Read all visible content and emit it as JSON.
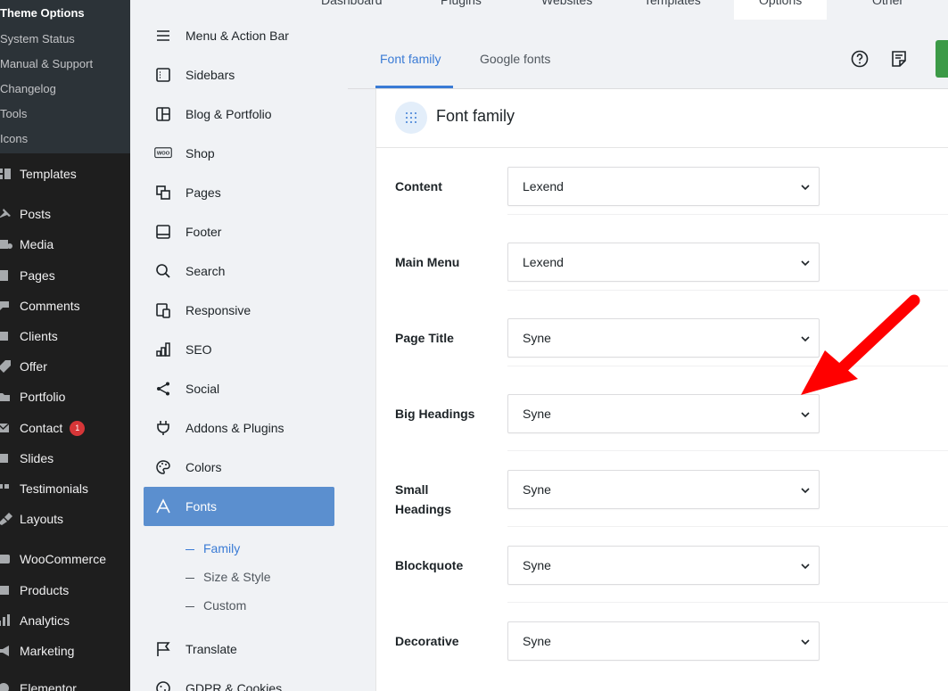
{
  "wp_sidebar": {
    "submenu": [
      "Theme Options",
      "System Status",
      "Manual & Support",
      "Changelog",
      "Tools",
      "Icons"
    ],
    "items": [
      "Templates",
      "Posts",
      "Media",
      "Pages",
      "Comments",
      "Clients",
      "Offer",
      "Portfolio",
      "Contact",
      "Slides",
      "Testimonials",
      "Layouts",
      "WooCommerce",
      "Products",
      "Analytics",
      "Marketing",
      "Elementor"
    ],
    "contact_badge": "1"
  },
  "top_tabs": [
    "Dashboard",
    "Plugins",
    "Websites",
    "Templates",
    "Options",
    "Other"
  ],
  "inner_nav": {
    "items": [
      "Menu & Action Bar",
      "Sidebars",
      "Blog & Portfolio",
      "Shop",
      "Pages",
      "Footer",
      "Search",
      "Responsive",
      "SEO",
      "Social",
      "Addons & Plugins",
      "Colors",
      "Fonts"
    ],
    "sub_items": [
      "Family",
      "Size & Style",
      "Custom"
    ],
    "after_items": [
      "Translate",
      "GDPR & Cookies"
    ],
    "shop_icon_text": "WOO"
  },
  "content_tabs": [
    "Font family",
    "Google fonts"
  ],
  "panel": {
    "title": "Font family",
    "rows": [
      {
        "label": "Content",
        "value": "Lexend"
      },
      {
        "label": "Main Menu",
        "value": "Lexend"
      },
      {
        "label": "Page Title",
        "value": "Syne"
      },
      {
        "label": "Big Headings",
        "value": "Syne"
      },
      {
        "label": "Small Headings",
        "value": "Syne"
      },
      {
        "label": "Blockquote",
        "value": "Syne"
      },
      {
        "label": "Decorative",
        "value": "Syne"
      }
    ]
  },
  "colors": {
    "accent": "#3a7bd5",
    "active_nav": "#5b8fcf",
    "arrow": "#ff0000",
    "wp_dark": "#1e1e1e"
  }
}
